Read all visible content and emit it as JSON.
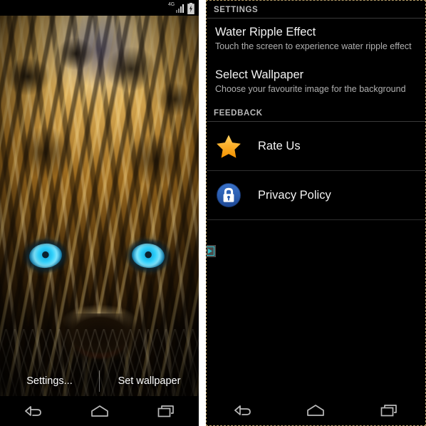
{
  "left_screen": {
    "name": "live-wallpaper-preview",
    "statusbar": {
      "network_label": "4G",
      "signal_icon": "signal-bars-icon",
      "battery_icon": "battery-charging-icon"
    },
    "wallpaper": {
      "subject": "leopard-face-live-wallpaper",
      "eye_color": "#2fd0fb",
      "fur_color": "#c9922f",
      "nose_color": "#b13a1c"
    },
    "actions": {
      "settings_label": "Settings...",
      "set_wallpaper_label": "Set wallpaper"
    },
    "navbar": {
      "back_label": "Back",
      "home_label": "Home",
      "recents_label": "Recent apps"
    }
  },
  "right_screen": {
    "name": "wallpaper-settings",
    "sections": [
      {
        "header": "SETTINGS",
        "rows": [
          {
            "title": "Water Ripple Effect",
            "summary": "Touch the screen to experience water ripple effect"
          },
          {
            "title": "Select Wallpaper",
            "summary": "Choose your favourite image for the background"
          }
        ]
      },
      {
        "header": "FEEDBACK",
        "rows": [
          {
            "title": "Rate Us",
            "icon": "star-icon",
            "icon_color": "#f5a623"
          },
          {
            "title": "Privacy Policy",
            "icon": "lock-icon",
            "icon_color": "#2a5db0"
          }
        ]
      }
    ],
    "media_handle": {
      "icon": "play-triangle-icon",
      "color": "#2bbfc9"
    },
    "navbar": {
      "back_label": "Back",
      "home_label": "Home",
      "recents_label": "Recent apps"
    }
  }
}
